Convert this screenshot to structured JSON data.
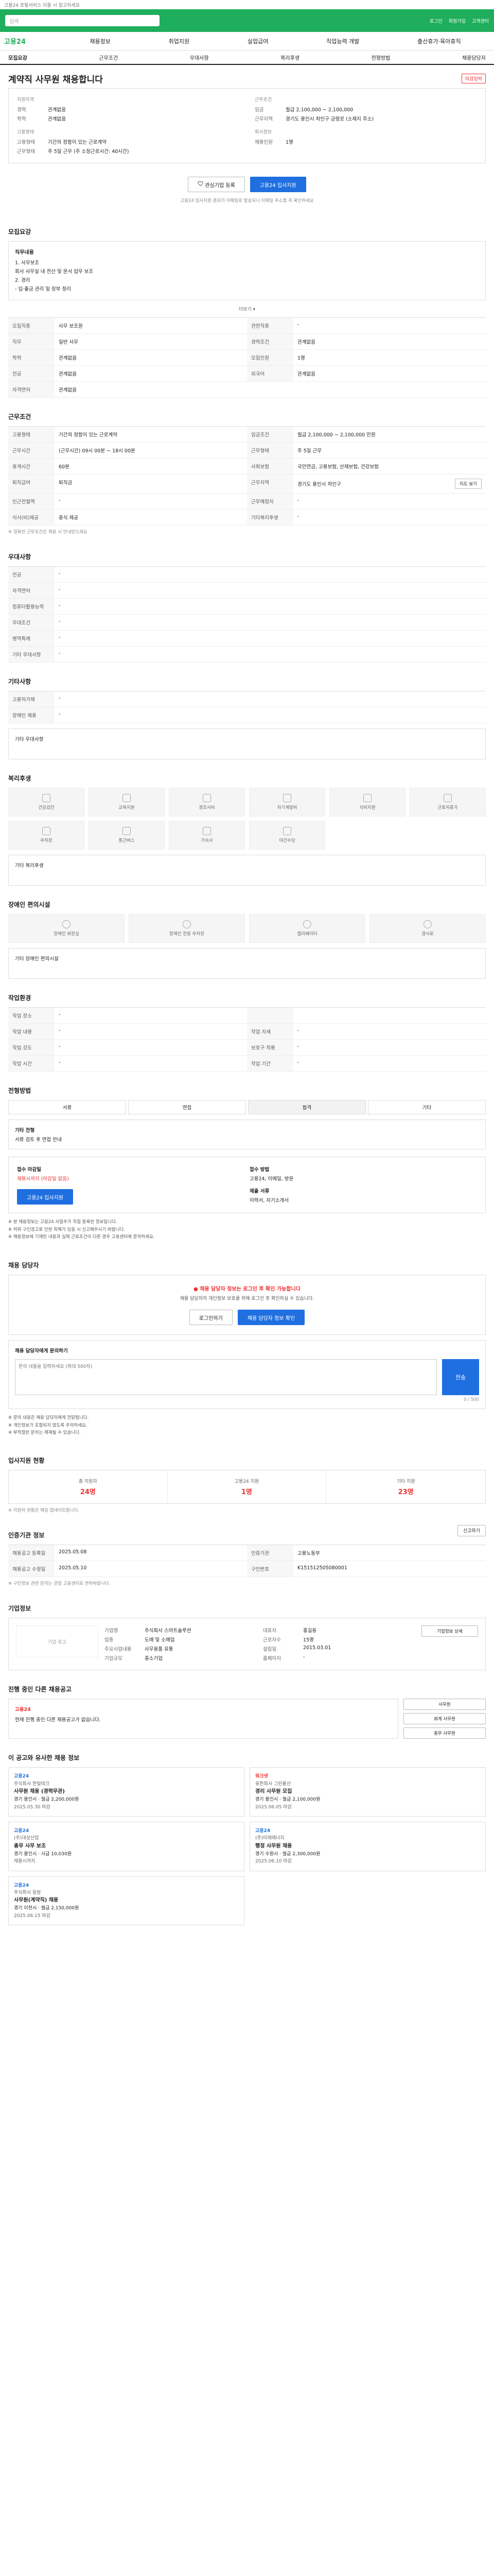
{
  "top_notice": "고용24 포털서비스 이용 시 참고하세요",
  "header": {
    "search_placeholder": "검색",
    "util_links": [
      "로그인",
      "회원가입",
      "고객센터"
    ]
  },
  "gnb": {
    "brand": "고용24",
    "menu": [
      "채용정보",
      "취업지원",
      "실업급여",
      "직업능력 개발",
      "출산휴가·육아휴직"
    ]
  },
  "tabs": [
    "모집요강",
    "근무조건",
    "우대사항",
    "복리후생",
    "전형방법",
    "채용담당자"
  ],
  "job": {
    "title": "계약직 사무원 채용합니다",
    "badge": "마감임박",
    "left_title": "지원자격",
    "left": [
      {
        "k": "경력",
        "v": "관계없음"
      },
      {
        "k": "학력",
        "v": "관계없음"
      }
    ],
    "left2_title": "고용형태",
    "left2": [
      {
        "k": "고용형태",
        "v": "기간의 정함이 있는 근로계약"
      },
      {
        "k": "근무형태",
        "v": "주 5일 근무 (주 소정근로시간: 40시간)"
      }
    ],
    "right_title": "근무조건",
    "right": [
      {
        "k": "임금",
        "v": "월급 2,100,000 ~ 2,100,000"
      },
      {
        "k": "근무지역",
        "v": "경기도 용인시 처인구 금령로 (소재지 주소)"
      }
    ],
    "right2_title": "회사정보",
    "right2": [
      {
        "k": "채용인원",
        "v": "1명"
      }
    ]
  },
  "buttons": {
    "interest": "관심기업 등록",
    "apply": "고용24 입사지원"
  },
  "apply_note": "고용24 입사지원 결과가 이메일로 발송되니 이메일 주소를 꼭 확인하세요",
  "recruit_section": {
    "title": "모집요강",
    "duty_title": "직무내용",
    "duty": [
      "1. 사무보조",
      "회사 사무실 내 전산 및 문서 업무 보조",
      "2. 경리",
      "- 입·출금 관리 및 장부 정리"
    ],
    "more": "더보기",
    "rows": [
      {
        "k1": "모집직종",
        "v1": "사무 보조원",
        "k2": "관련직종",
        "v2": "-"
      },
      {
        "k1": "직무",
        "v1": "일반 사무",
        "k2": "경력조건",
        "v2": "관계없음"
      },
      {
        "k1": "학력",
        "v1": "관계없음",
        "k2": "모집인원",
        "v2": "1명"
      },
      {
        "k1": "전공",
        "v1": "관계없음",
        "k2": "외국어",
        "v2": "관계없음"
      }
    ],
    "license": {
      "k": "자격면허",
      "v": "관계없음"
    }
  },
  "conditions": {
    "title": "근무조건",
    "rows": [
      {
        "k1": "고용형태",
        "v1": "기간의 정함이 있는 근로계약",
        "k2": "임금조건",
        "v2": "월급 2,100,000 ~ 2,100,000 만원"
      },
      {
        "k1": "근무시간",
        "v1": "(근무시간) 09시 00분 ~ 18시 00분",
        "k2": "근무형태",
        "v2": "주 5일 근무"
      },
      {
        "k1": "휴게시간",
        "v1": "60분",
        "k2": "사회보험",
        "v2": "국민연금, 고용보험, 산재보험, 건강보험"
      },
      {
        "k1": "퇴직급여",
        "v1": "퇴직금",
        "k2": "근무지역",
        "v2": "경기도 용인시 처인구"
      },
      {
        "k1": "인근전철역",
        "v1": "-",
        "k2": "근무예정지",
        "v2": "-"
      },
      {
        "k1": "식사(비)제공",
        "v1": "중식 제공",
        "k2": "기타복리후생",
        "v2": "-"
      }
    ],
    "map_btn": "지도 보기",
    "note": "※ 정확한 근무조건은 채용 시 안내받으세요"
  },
  "preference": {
    "title": "우대사항",
    "rows": [
      {
        "k": "전공",
        "v": "-"
      },
      {
        "k": "자격면허",
        "v": "-"
      },
      {
        "k": "컴퓨터활용능력",
        "v": "-"
      },
      {
        "k": "우대조건",
        "v": "-"
      },
      {
        "k": "병역특례",
        "v": "-"
      },
      {
        "k": "기타 우대사항",
        "v": "-"
      }
    ]
  },
  "other": {
    "title": "기타사항",
    "rows": [
      {
        "k": "고용허가제",
        "v": "-"
      },
      {
        "k": "장애인 채용",
        "v": "-"
      }
    ],
    "extra": "기타 우대사항"
  },
  "welfare": {
    "title": "복리후생",
    "items": [
      "건강검진",
      "교육지원",
      "경조사비",
      "자기계발비",
      "식비지원",
      "근로자휴가",
      "주차장",
      "통근버스",
      "기숙사",
      "야간수당"
    ],
    "etc_label": "기타 복리후생"
  },
  "disabled": {
    "title": "장애인 편의시설",
    "items": [
      "장애인 화장실",
      "장애인 전용 주차장",
      "엘리베이터",
      "경사로"
    ],
    "etc_label": "기타 장애인 편의시설"
  },
  "job_env": {
    "title": "작업환경",
    "rows": [
      {
        "k1": "작업 장소",
        "v1": "-",
        "k2": "",
        "v2": ""
      },
      {
        "k1": "작업 내용",
        "v1": "-",
        "k2": "작업 자세",
        "v2": "-"
      },
      {
        "k1": "작업 강도",
        "v1": "-",
        "k2": "보호구 착용",
        "v2": "-"
      },
      {
        "k1": "작업 시간",
        "v1": "-",
        "k2": "작업 기간",
        "v2": "-"
      }
    ]
  },
  "selection": {
    "title": "전형방법",
    "steps": [
      "서류",
      "면접",
      "합격",
      "기타"
    ],
    "extra_label": "기타 전형",
    "extra_value": "서류 검토 후 면접 안내"
  },
  "apply_info": {
    "deadline_label": "접수 마감일",
    "deadline_value": "채용시까지 (마감일 없음)",
    "method_label": "접수 방법",
    "method_value": "고용24, 이메일, 방문",
    "docs_label": "제출 서류",
    "docs_value": "이력서, 자기소개서",
    "apply_btn": "고용24 입사지원",
    "warn": [
      "※ 본 채용정보는 고용24 사업주가 직접 등록한 정보입니다.",
      "※ 허위 구인광고로 인한 피해가 있을 시 신고해주시기 바랍니다.",
      "※ 채용정보에 기재된 내용과 실제 근로조건이 다른 경우 고용센터에 문의하세요."
    ]
  },
  "manager": {
    "title": "채용 담당자",
    "alert": "채용 담당자 정보는 로그인 후 확인 가능합니다",
    "desc": "채용 담당자의 개인정보 보호를 위해 로그인 후 확인하실 수 있습니다.",
    "btn_manager": "채용 담당자 정보 확인",
    "btn_login": "로그인하기",
    "inquiry_label": "채용 담당자에게 문의하기",
    "inquiry_placeholder": "문의 내용을 입력하세요 (최대 500자)",
    "inquiry_count": "0 / 500",
    "inquiry_send": "전송",
    "notes": [
      "※ 문의 내용은 채용 담당자에게 전달됩니다.",
      "※ 개인정보가 포함되지 않도록 주의하세요.",
      "※ 부적절한 문의는 제재될 수 있습니다."
    ]
  },
  "applicants": {
    "title": "입사지원 현황",
    "stats": [
      {
        "label": "총 지원자",
        "value": "24명"
      },
      {
        "label": "고용24 지원",
        "value": "1명"
      },
      {
        "label": "기타 지원",
        "value": "23명"
      }
    ],
    "note": "※ 지원자 현황은 매일 업데이트됩니다."
  },
  "posting": {
    "title": "인증기관 정보",
    "btn": "신고하기",
    "rows": [
      {
        "k1": "채용공고 등록일",
        "v1": "2025.05.08",
        "k2": "인증기관",
        "v2": "고용노동부"
      },
      {
        "k1": "채용공고 수정일",
        "v1": "2025.05.10",
        "k2": "구인번호",
        "v2": "K151512505080001"
      }
    ],
    "note": "※ 구인정보 관련 문의는 관할 고용센터로 연락바랍니다."
  },
  "company": {
    "title": "기업정보",
    "logo": "기업 로고",
    "btn": "기업정보 상세",
    "left": [
      {
        "k": "기업명",
        "v": "주식회사 스마트솔루션"
      },
      {
        "k": "업종",
        "v": "도매 및 소매업"
      },
      {
        "k": "주요사업내용",
        "v": "사무용품 유통"
      },
      {
        "k": "기업규모",
        "v": "중소기업"
      }
    ],
    "right": [
      {
        "k": "대표자",
        "v": "홍길동"
      },
      {
        "k": "근로자수",
        "v": "15명"
      },
      {
        "k": "설립일",
        "v": "2015.03.01"
      },
      {
        "k": "홈페이지",
        "v": "-"
      }
    ]
  },
  "other_jobs": {
    "title": "진행 중인 다른 채용공고",
    "highlight": "고용24",
    "desc": "현재 진행 중인 다른 채용공고가 없습니다.",
    "side": [
      "사무원",
      "회계 사무원",
      "총무 사무원"
    ]
  },
  "recommended": {
    "title": "이 공고와 유사한 채용 정보",
    "cards": [
      {
        "tag": "고용24",
        "tag_color": "blue",
        "company": "주식회사 한빛테크",
        "title": "사무원 채용 (경력무관)",
        "meta": "경기 용인시 · 월급 2,200,000원",
        "date": "2025.05.30 마감"
      },
      {
        "tag": "워크넷",
        "tag_color": "red",
        "company": "유한회사 그린물산",
        "title": "경리 사무원 모집",
        "meta": "경기 용인시 · 월급 2,100,000원",
        "date": "2025.06.05 마감"
      },
      {
        "tag": "고용24",
        "tag_color": "blue",
        "company": "(주)대성산업",
        "title": "총무 사무 보조",
        "meta": "경기 용인시 · 시급 10,030원",
        "date": "채용시까지"
      },
      {
        "tag": "고용24",
        "tag_color": "blue",
        "company": "(주)미래에너지",
        "title": "행정 사무원 채용",
        "meta": "경기 수원시 · 월급 2,300,000원",
        "date": "2025.06.10 마감"
      },
      {
        "tag": "고용24",
        "tag_color": "blue",
        "company": "주식회사 동방",
        "title": "사무원(계약직) 채용",
        "meta": "경기 이천시 · 월급 2,150,000원",
        "date": "2025.06.15 마감"
      }
    ]
  }
}
